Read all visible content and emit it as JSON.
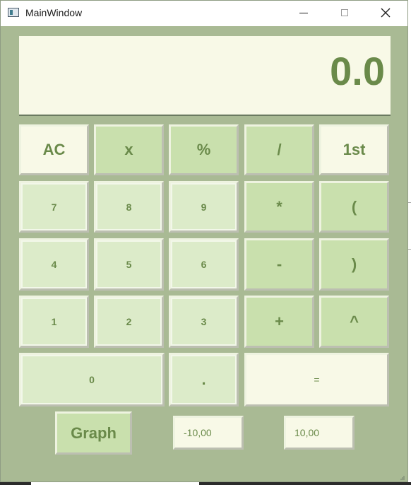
{
  "window": {
    "title": "MainWindow"
  },
  "display": {
    "value": "0.0"
  },
  "keypad": {
    "row1": [
      "AC",
      "x",
      "%",
      "/",
      "1st"
    ],
    "row2": [
      "7",
      "8",
      "9",
      "*",
      "("
    ],
    "row3": [
      "4",
      "5",
      "6",
      "-",
      ")"
    ],
    "row4": [
      "1",
      "2",
      "3",
      "+",
      "^"
    ],
    "row5": [
      "0",
      ".",
      "="
    ]
  },
  "graph": {
    "button_label": "Graph",
    "x_min": "-10,00",
    "x_max": "10,00"
  },
  "colors": {
    "background": "#a9ba94",
    "display_bg": "#f8f9e7",
    "accent_text": "#6a8a4a",
    "key_mid": "#c9e0ad",
    "key_pale": "#dcebc9"
  }
}
